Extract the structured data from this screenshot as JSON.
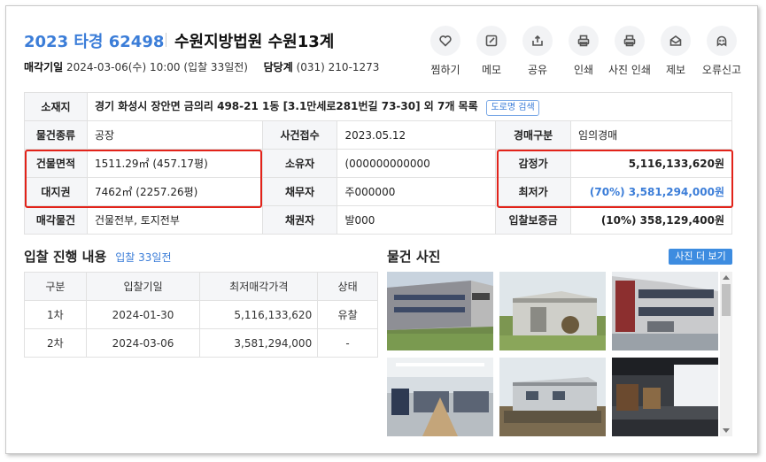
{
  "header": {
    "case_no": "2023 타경 62498",
    "court": "수원지방법원 수원13계",
    "sale_date_label": "매각기일",
    "sale_date_value": "2024-03-06(수) 10:00 (입찰 33일전)",
    "dept_label": "담당계",
    "dept_value": "(031) 210-1273"
  },
  "actions": [
    {
      "label": "찜하기",
      "icon": "heart-icon"
    },
    {
      "label": "메모",
      "icon": "memo-icon"
    },
    {
      "label": "공유",
      "icon": "share-icon"
    },
    {
      "label": "인쇄",
      "icon": "print-icon"
    },
    {
      "label": "사진 인쇄",
      "icon": "photo-print-icon"
    },
    {
      "label": "제보",
      "icon": "mail-icon"
    },
    {
      "label": "오류신고",
      "icon": "alert-icon"
    }
  ],
  "info": {
    "location_label": "소재지",
    "location_value": "경기 화성시 장안면 금의리 498-21 1동 [3.1만세로281번길 73-30] 외 7개 목록",
    "road_btn": "도로명 검색",
    "type_label": "물건종류",
    "type_value": "공장",
    "case_recv_label": "사건접수",
    "case_recv_value": "2023.05.12",
    "auction_type_label": "경매구분",
    "auction_type_value": "임의경매",
    "building_area_label": "건물면적",
    "building_area_value": "1511.29㎡ (457.17평)",
    "owner_label": "소유자",
    "owner_value": "(000000000000",
    "appraisal_label": "감정가",
    "appraisal_value": "5,116,133,620원",
    "land_label": "대지권",
    "land_value": "7462㎡ (2257.26평)",
    "debtor_label": "채무자",
    "debtor_value": "주000000",
    "min_price_label": "최저가",
    "min_price_value": "(70%) 3,581,294,000원",
    "sale_item_label": "매각물건",
    "sale_item_value": "건물전부, 토지전부",
    "creditor_label": "채권자",
    "creditor_value": "발000",
    "deposit_label": "입찰보증금",
    "deposit_value": "(10%) 358,129,400원"
  },
  "bid_section": {
    "title": "입찰 진행 내용",
    "subtitle": "입찰 33일전",
    "headers": [
      "구분",
      "입찰기일",
      "최저매각가격",
      "상태"
    ],
    "rows": [
      [
        "1차",
        "2024-01-30",
        "5,116,133,620",
        "유찰"
      ],
      [
        "2차",
        "2024-03-06",
        "3,581,294,000",
        "-"
      ]
    ]
  },
  "photo_section": {
    "title": "물건 사진",
    "more_btn": "사진 더 보기"
  },
  "colors": {
    "accent": "#3b7dd8",
    "highlight_box": "#e2231a",
    "header_cell_bg": "#f5f6f8"
  }
}
